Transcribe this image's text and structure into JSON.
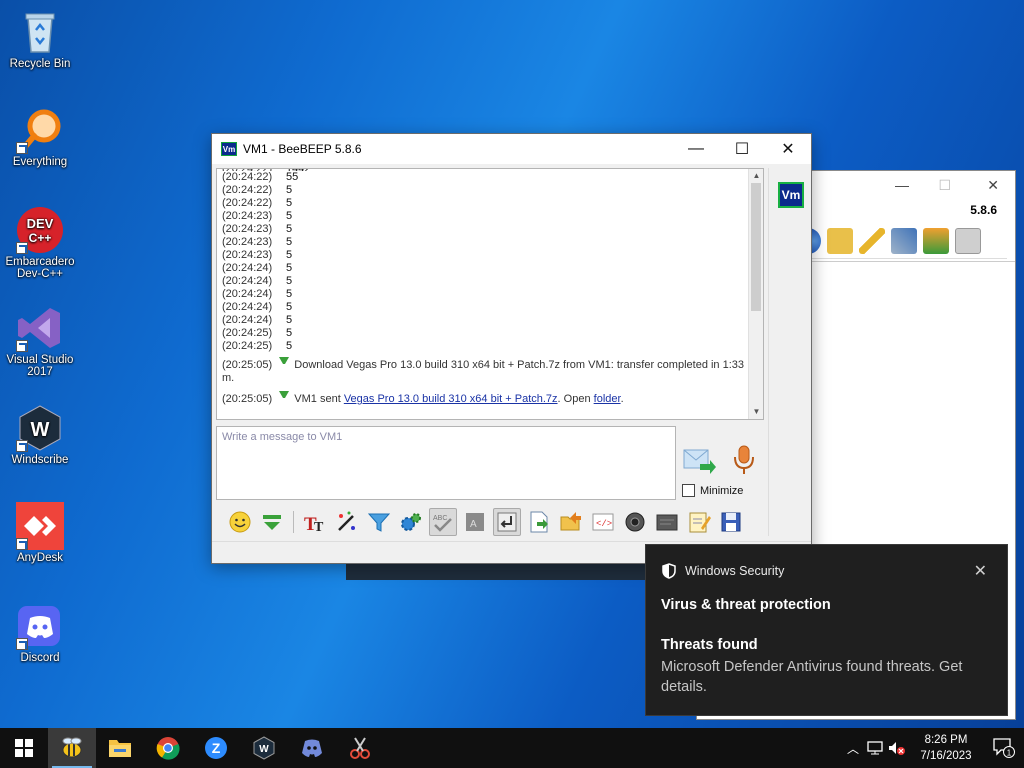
{
  "desktop": {
    "icons": [
      {
        "label": "Recycle Bin"
      },
      {
        "label": "Everything"
      },
      {
        "label": "Embarcadero Dev-C++"
      },
      {
        "label": "Visual Studio 2017"
      },
      {
        "label": "Windscribe"
      },
      {
        "label": "AnyDesk"
      },
      {
        "label": "Discord"
      }
    ]
  },
  "back_window": {
    "version": "5.8.6"
  },
  "window": {
    "title": "VM1 - BeeBEEP 5.8.6",
    "app_icon_text": "Vm",
    "chat": {
      "first_line": {
        "time": "(20:24:22)",
        "msg": "55"
      },
      "lines": [
        {
          "time": "(20:24:22)",
          "msg": "5"
        },
        {
          "time": "(20:24:22)",
          "msg": "5"
        },
        {
          "time": "(20:24:23)",
          "msg": "5"
        },
        {
          "time": "(20:24:23)",
          "msg": "5"
        },
        {
          "time": "(20:24:23)",
          "msg": "5"
        },
        {
          "time": "(20:24:23)",
          "msg": "5"
        },
        {
          "time": "(20:24:24)",
          "msg": "5"
        },
        {
          "time": "(20:24:24)",
          "msg": "5"
        },
        {
          "time": "(20:24:24)",
          "msg": "5"
        },
        {
          "time": "(20:24:24)",
          "msg": "5"
        },
        {
          "time": "(20:24:24)",
          "msg": "5"
        },
        {
          "time": "(20:24:25)",
          "msg": "5"
        },
        {
          "time": "(20:24:25)",
          "msg": "5"
        }
      ],
      "transfer": {
        "time": "(20:25:05)",
        "text": "Download Vegas Pro 13.0 build 310 x64 bit + Patch.7z from VM1: transfer completed in 1:33 m."
      },
      "sent": {
        "time": "(20:25:05)",
        "prefix": "VM1 sent",
        "file_link": "Vegas Pro 13.0 build 310 x64 bit + Patch.7z",
        "middle": ". Open",
        "folder_link": "folder",
        "suffix": "."
      }
    },
    "user_badge": "Vm",
    "compose_placeholder": "Write a message to VM1",
    "minimize_label": "Minimize",
    "minimize_checked": false
  },
  "toast": {
    "app": "Windows Security",
    "title": "Virus & threat protection",
    "subtitle": "Threats found",
    "body": "Microsoft Defender Antivirus found threats. Get details."
  },
  "taskbar": {
    "time": "8:26 PM",
    "date": "7/16/2023",
    "notification_count": "1"
  },
  "colors": {
    "accent": "#0b2a8c",
    "toast_bg": "#1f1f1f",
    "link": "#1a33a6"
  }
}
